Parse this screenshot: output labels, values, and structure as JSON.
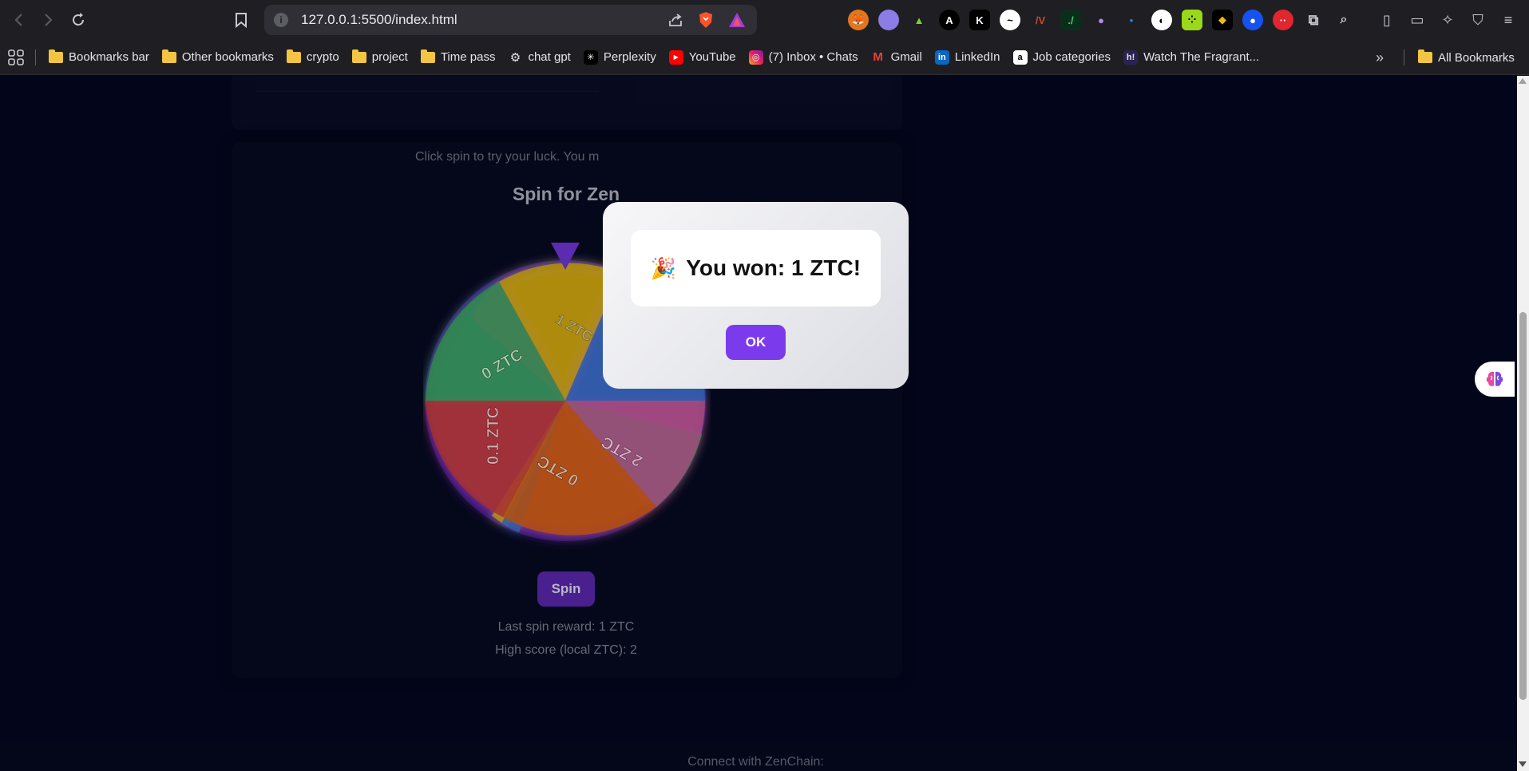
{
  "browser": {
    "url": "127.0.0.1:5500/index.html"
  },
  "bookmarks": [
    {
      "label": "Bookmarks bar",
      "icon": "folder-icon"
    },
    {
      "label": "Other bookmarks",
      "icon": "folder-icon"
    },
    {
      "label": "crypto",
      "icon": "folder-icon"
    },
    {
      "label": "project",
      "icon": "folder-icon"
    },
    {
      "label": "Time pass",
      "icon": "folder-icon"
    },
    {
      "label": "chat gpt",
      "icon": "chatgpt-icon"
    },
    {
      "label": "Perplexity",
      "icon": "perplexity-icon"
    },
    {
      "label": "YouTube",
      "icon": "youtube-icon"
    },
    {
      "label": "(7) Inbox • Chats",
      "icon": "instagram-icon"
    },
    {
      "label": "Gmail",
      "icon": "gmail-icon"
    },
    {
      "label": "LinkedIn",
      "icon": "linkedin-icon"
    },
    {
      "label": "Job categories",
      "icon": "amazon-icon"
    },
    {
      "label": "Watch The Fragrant...",
      "icon": "hianime-icon"
    },
    {
      "label": "All Bookmarks",
      "icon": "folder-icon"
    }
  ],
  "game": {
    "title": "Spin for Zen",
    "subtitle": "Click spin to try your luck. You m",
    "spin_label": "Spin",
    "last_reward": "Last spin reward: 1 ZTC",
    "high_score": "High score (local ZTC): 2"
  },
  "wheel": {
    "segments": [
      {
        "label": "1 ZTC",
        "color": "#b59206"
      },
      {
        "label": "",
        "color": "#2f5ea8"
      },
      {
        "label": "2 ZTC",
        "color": "#a64a7d"
      },
      {
        "label": "0 ZTC",
        "color": "#b54f0c"
      },
      {
        "label": "0.1 ZTC",
        "color": "#a53131"
      },
      {
        "label": "0 ZTC",
        "color": "#2e8b4d"
      }
    ],
    "pointer_color": "#5b2bb0"
  },
  "modal": {
    "message": "You won: 1 ZTC!",
    "ok_label": "OK",
    "icon": "party-popper-icon"
  },
  "footer": {
    "connect_text": "Connect with ZenChain:"
  },
  "colors": {
    "accent": "#7c3aed",
    "page_bg": "#03061a"
  }
}
